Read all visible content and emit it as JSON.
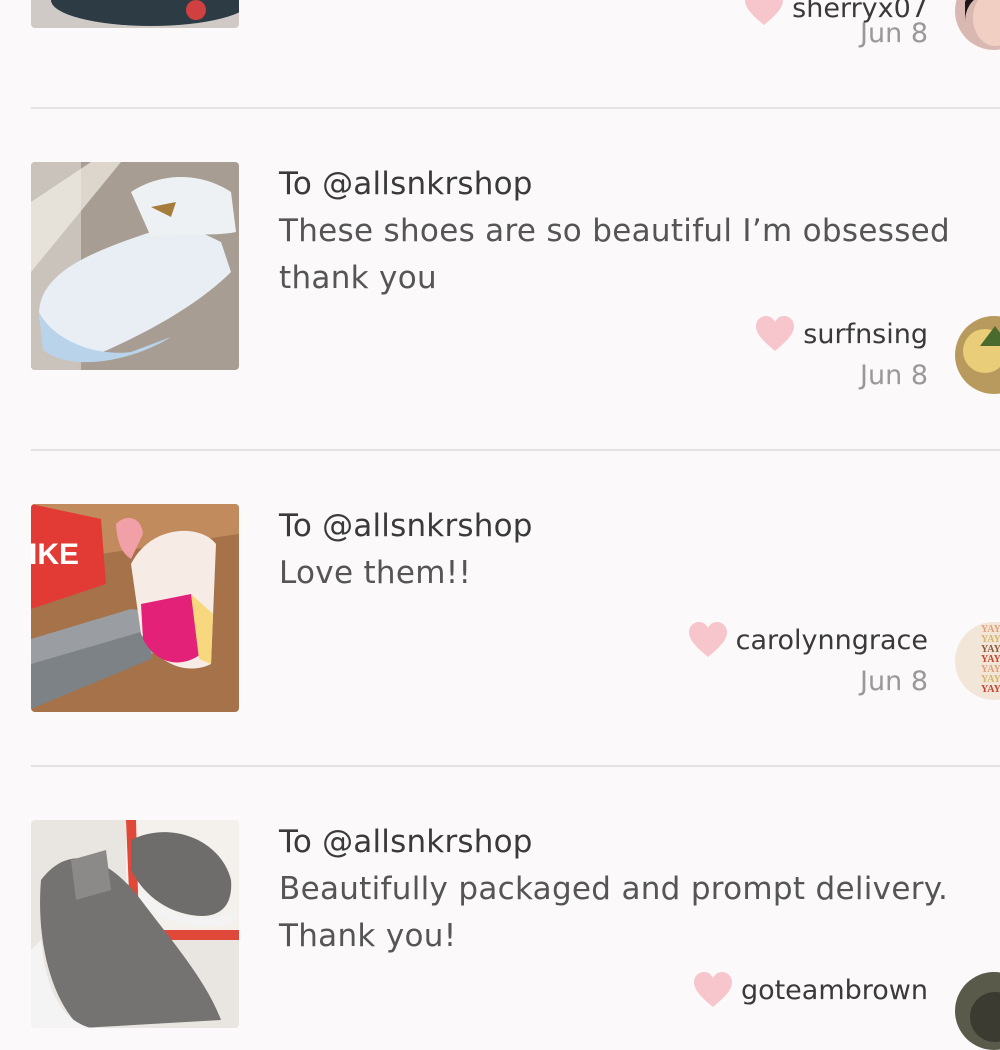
{
  "reviews": [
    {
      "to": "",
      "message": "",
      "username": "sherryx07",
      "date": "Jun 8"
    },
    {
      "to": "To @allsnkrshop",
      "message": "These shoes are so beautiful I’m obsessed thank you",
      "username": "surfnsing",
      "date": "Jun 8"
    },
    {
      "to": "To @allsnkrshop",
      "message": "Love them!!",
      "username": "carolynngrace",
      "date": "Jun 8"
    },
    {
      "to": "To @allsnkrshop",
      "message": "Beautifully packaged and prompt delivery. Thank you!",
      "username": "goteambrown",
      "date": ""
    }
  ],
  "images": {
    "review2_box_text": "IKE",
    "review3_avatar_text": "YAY"
  },
  "colors": {
    "heart": "#f7c6cc",
    "divider": "#e4e2e3",
    "background": "#fbf9fa"
  }
}
